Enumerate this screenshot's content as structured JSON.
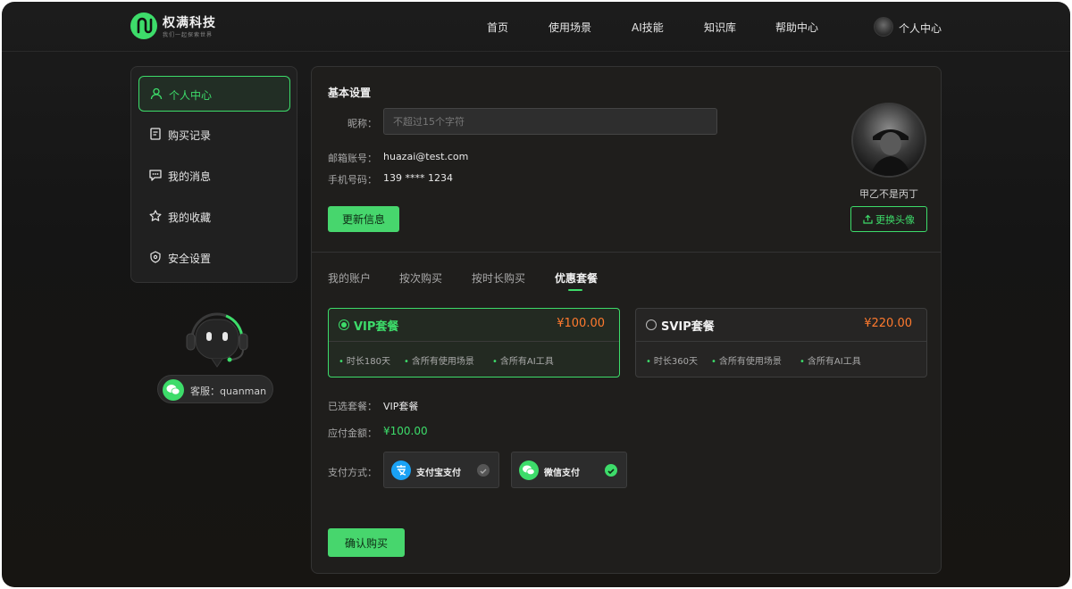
{
  "brand": {
    "name": "权满科技",
    "slogan": "我们一起探索世界"
  },
  "nav": {
    "items": [
      {
        "label": "首页"
      },
      {
        "label": "使用场景"
      },
      {
        "label": "AI技能"
      },
      {
        "label": "知识库"
      },
      {
        "label": "帮助中心"
      }
    ],
    "user_label": "个人中心"
  },
  "sidebar": {
    "items": [
      {
        "label": "个人中心",
        "icon": "user-icon",
        "active": true
      },
      {
        "label": "购买记录",
        "icon": "document-icon",
        "active": false
      },
      {
        "label": "我的消息",
        "icon": "message-icon",
        "active": false
      },
      {
        "label": "我的收藏",
        "icon": "star-icon",
        "active": false
      },
      {
        "label": "安全设置",
        "icon": "shield-icon",
        "active": false
      }
    ]
  },
  "support": {
    "label": "客服：quanman",
    "icon": "wechat-icon"
  },
  "basic": {
    "title": "基本设置",
    "nickname_label": "昵称：",
    "nickname_placeholder": "不超过15个字符",
    "nickname_value": "",
    "email_label": "邮箱账号：",
    "email_value": "huazai@test.com",
    "phone_label": "手机号码：",
    "phone_value": "139 **** 1234",
    "update_button": "更新信息",
    "avatar_name": "甲乙不是丙丁",
    "change_avatar_button": "更换头像"
  },
  "tabs": [
    {
      "label": "我的账户",
      "active": false
    },
    {
      "label": "按次购买",
      "active": false
    },
    {
      "label": "按时长购买",
      "active": false
    },
    {
      "label": "优惠套餐",
      "active": true
    }
  ],
  "plans": [
    {
      "name": "VIP套餐",
      "price": "¥100.00",
      "selected": true,
      "features": [
        "时长180天",
        "含所有使用场景",
        "含所有AI工具"
      ]
    },
    {
      "name": "SVIP套餐",
      "price": "¥220.00",
      "selected": false,
      "features": [
        "时长360天",
        "含所有使用场景",
        "含所有AI工具"
      ]
    }
  ],
  "order": {
    "selected_label": "已选套餐：",
    "selected_value": "VIP套餐",
    "amount_label": "应付金额：",
    "amount_value": "¥100.00",
    "payment_label": "支付方式：",
    "payment_methods": [
      {
        "label": "支付宝支付",
        "icon": "alipay-icon",
        "checked": false
      },
      {
        "label": "微信支付",
        "icon": "wechat-pay-icon",
        "checked": true
      }
    ],
    "confirm_button": "确认购买"
  },
  "colors": {
    "accent": "#3ddc6a",
    "price": "#ff7a2e",
    "alipay": "#1aa2f5"
  }
}
